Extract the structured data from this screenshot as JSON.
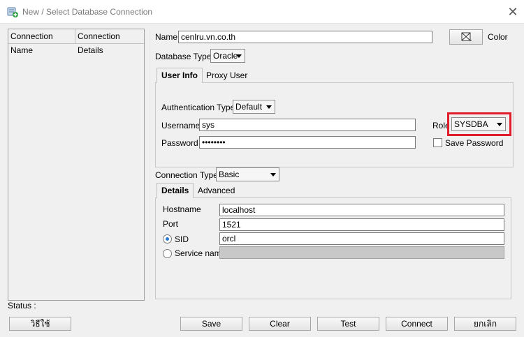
{
  "window": {
    "title": "New / Select Database Connection",
    "close_glyph": "✕"
  },
  "list": {
    "col_name": "Connection Name",
    "col_details": "Connection Details"
  },
  "status_label": "Status :",
  "form": {
    "name_label": "Name",
    "name_value": "cenlru.vn.co.th",
    "color_label": "Color",
    "db_type_label": "Database Type",
    "db_type_value": "Oracle",
    "tabs": [
      "User Info",
      "Proxy User"
    ],
    "auth_type_label": "Authentication Type",
    "auth_type_value": "Default",
    "username_label": "Username",
    "username_value": "sys",
    "password_label": "Password",
    "password_value": "••••••••",
    "role_label": "Role",
    "role_value": "SYSDBA",
    "save_password_label": "Save Password",
    "conn_type_label": "Connection Type",
    "conn_type_value": "Basic",
    "conn_tabs": [
      "Details",
      "Advanced"
    ],
    "hostname_label": "Hostname",
    "hostname_value": "localhost",
    "port_label": "Port",
    "port_value": "1521",
    "sid_label": "SID",
    "sid_value": "orcl",
    "service_label": "Service name",
    "service_value": ""
  },
  "buttons": {
    "help": "วิธีใช้",
    "save": "Save",
    "clear": "Clear",
    "test": "Test",
    "connect": "Connect",
    "cancel": "ยกเลิก"
  },
  "colors": {
    "highlight": "#e21d2b",
    "accent": "#2a7bd4"
  },
  "icons": {
    "app": "database-add-icon",
    "color_picker": "color-picker-icon",
    "close": "close-icon"
  }
}
